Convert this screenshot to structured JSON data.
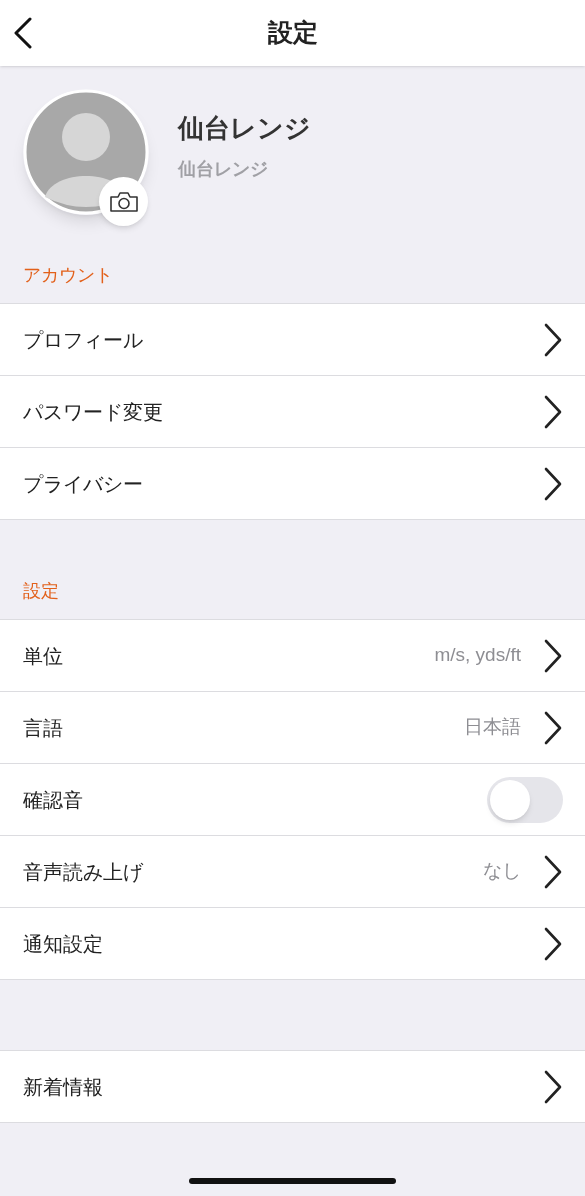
{
  "header": {
    "title": "設定"
  },
  "profile": {
    "name": "仙台レンジ",
    "subtitle": "仙台レンジ"
  },
  "sections": [
    {
      "title": "アカウント",
      "items": [
        {
          "kind": "link",
          "label": "プロフィール"
        },
        {
          "kind": "link",
          "label": "パスワード変更"
        },
        {
          "kind": "link",
          "label": "プライバシー"
        }
      ]
    },
    {
      "title": "設定",
      "items": [
        {
          "kind": "link",
          "label": "単位",
          "value": "m/s, yds/ft"
        },
        {
          "kind": "link",
          "label": "言語",
          "value": "日本語"
        },
        {
          "kind": "toggle",
          "label": "確認音",
          "on": false
        },
        {
          "kind": "link",
          "label": "音声読み上げ",
          "value": "なし"
        },
        {
          "kind": "link",
          "label": "通知設定"
        }
      ]
    },
    {
      "items": [
        {
          "kind": "link",
          "label": "新着情報"
        }
      ]
    }
  ]
}
